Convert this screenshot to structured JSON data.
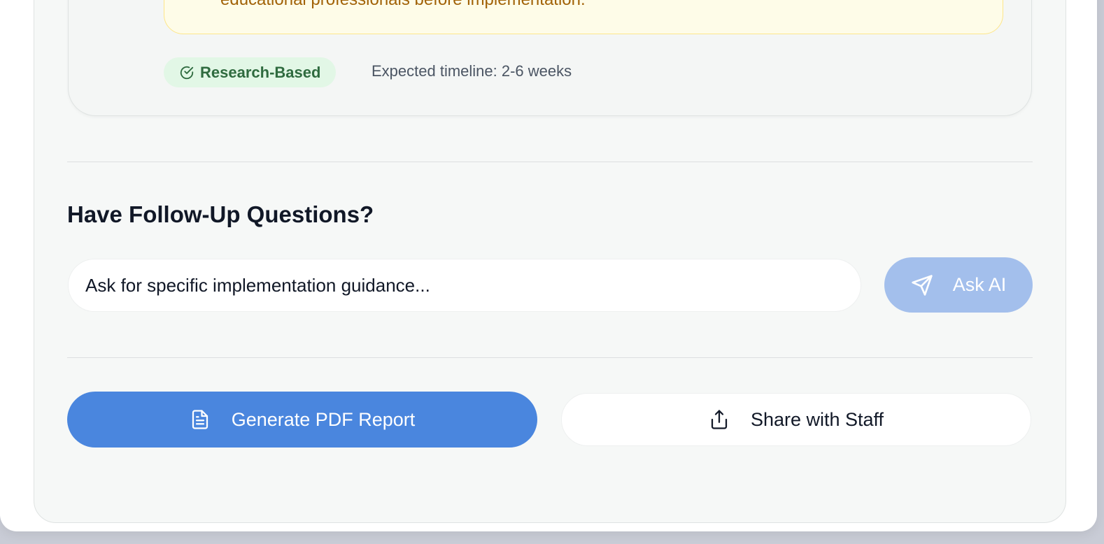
{
  "recommendation_card": {
    "warning_text": "educational professionals before implementation.",
    "badge_label": "Research-Based",
    "timeline_text": "Expected timeline: 2-6 weeks"
  },
  "followup": {
    "title": "Have Follow-Up Questions?",
    "input_placeholder": "Ask for specific implementation guidance...",
    "ask_button_label": "Ask AI"
  },
  "actions": {
    "pdf_button_label": "Generate PDF Report",
    "share_button_label": "Share with Staff"
  },
  "colors": {
    "primary": "#4a86de",
    "primary_disabled": "#a3bfec",
    "badge_bg": "#e2f7e6",
    "badge_text": "#2f6b3f",
    "warning_bg": "#fefce8",
    "warning_text": "#a16207"
  }
}
